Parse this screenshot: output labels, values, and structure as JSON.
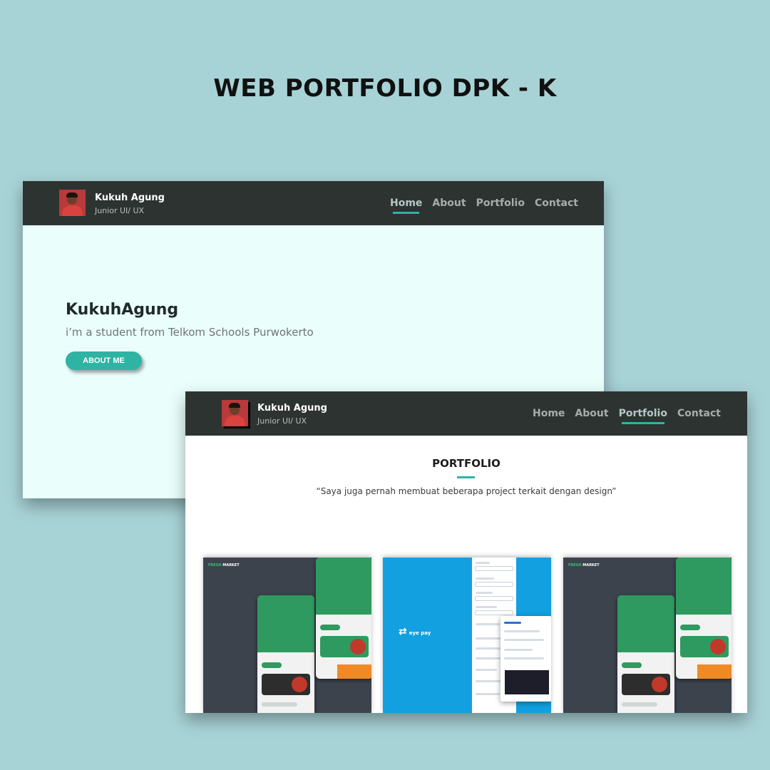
{
  "page": {
    "title": "WEB PORTFOLIO DPK - K"
  },
  "profile": {
    "name": "Kukuh Agung",
    "role": "Junior UI/ UX"
  },
  "nav": {
    "items": [
      "Home",
      "About",
      "Portfolio",
      "Contact"
    ]
  },
  "home": {
    "hero_name": "KukuhAgung",
    "hero_subtitle": "i’m a student from Telkom Schools Purwokerto",
    "about_button": "ABOUT ME",
    "active_nav": "Home"
  },
  "portfolio": {
    "heading": "PORTFOLIO",
    "quote": "“Saya juga pernah membuat beberapa project terkait dengan design”",
    "active_nav": "Portfolio",
    "thumbnails": [
      {
        "brand": "FRESH",
        "brand_suffix": "MARKET"
      },
      {
        "brand": "eye pay"
      },
      {
        "brand": "FRESH",
        "brand_suffix": "MARKET"
      }
    ]
  },
  "colors": {
    "background": "#a8d3d6",
    "navbar": "#2c3331",
    "accent": "#2fb3a3",
    "hero_bg": "#eafffc"
  }
}
